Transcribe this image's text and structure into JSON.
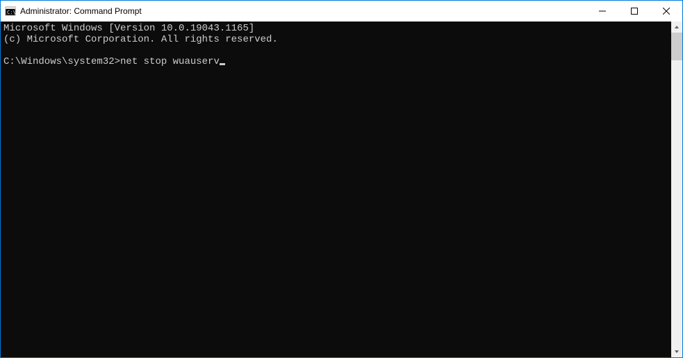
{
  "window": {
    "title": "Administrator: Command Prompt"
  },
  "terminal": {
    "header_line1": "Microsoft Windows [Version 10.0.19043.1165]",
    "header_line2": "(c) Microsoft Corporation. All rights reserved.",
    "prompt": "C:\\Windows\\system32>",
    "command": "net stop wuauserv"
  }
}
